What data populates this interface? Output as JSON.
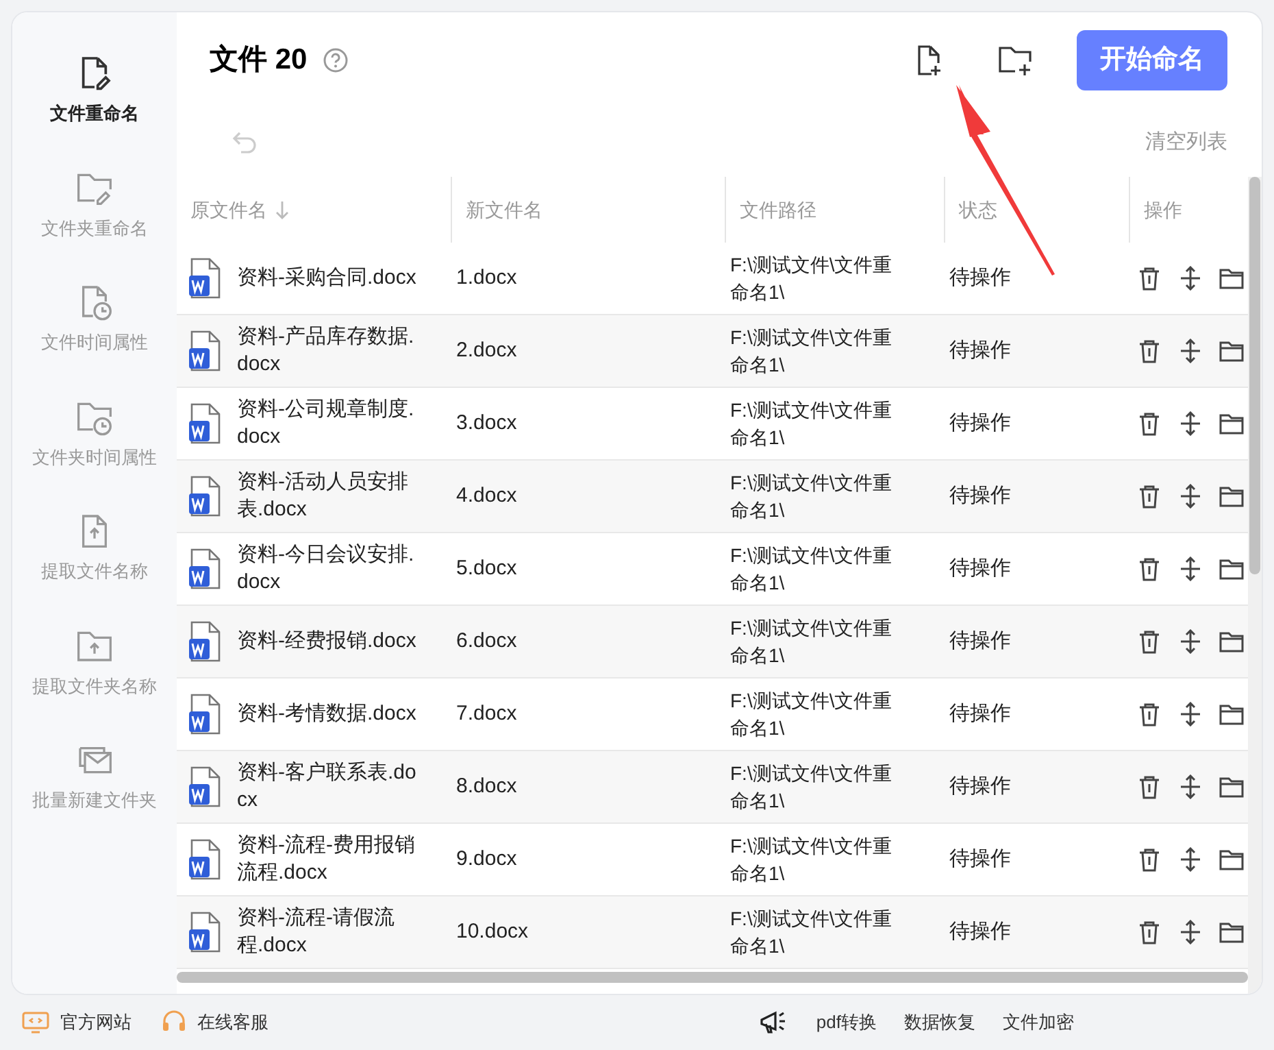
{
  "sidebar": {
    "items": [
      {
        "label": "文件重命名",
        "selected": true
      },
      {
        "label": "文件夹重命名",
        "selected": false
      },
      {
        "label": "文件时间属性",
        "selected": false
      },
      {
        "label": "文件夹时间属性",
        "selected": false
      },
      {
        "label": "提取文件名称",
        "selected": false
      },
      {
        "label": "提取文件夹名称",
        "selected": false
      },
      {
        "label": "批量新建文件夹",
        "selected": false
      }
    ]
  },
  "header": {
    "title": "文件 20",
    "start_button": "开始命名",
    "clear_list": "清空列表"
  },
  "table": {
    "columns": [
      "原文件名",
      "新文件名",
      "文件路径",
      "状态",
      "操作"
    ],
    "rows": [
      {
        "original": "资料-采购合同.docx",
        "new": "1.docx",
        "path": "F:\\测试文件\\文件重命名1\\",
        "status": "待操作"
      },
      {
        "original": "资料-产品库存数据.docx",
        "new": "2.docx",
        "path": "F:\\测试文件\\文件重命名1\\",
        "status": "待操作"
      },
      {
        "original": "资料-公司规章制度.docx",
        "new": "3.docx",
        "path": "F:\\测试文件\\文件重命名1\\",
        "status": "待操作"
      },
      {
        "original": "资料-活动人员安排表.docx",
        "new": "4.docx",
        "path": "F:\\测试文件\\文件重命名1\\",
        "status": "待操作"
      },
      {
        "original": "资料-今日会议安排.docx",
        "new": "5.docx",
        "path": "F:\\测试文件\\文件重命名1\\",
        "status": "待操作"
      },
      {
        "original": "资料-经费报销.docx",
        "new": "6.docx",
        "path": "F:\\测试文件\\文件重命名1\\",
        "status": "待操作"
      },
      {
        "original": "资料-考情数据.docx",
        "new": "7.docx",
        "path": "F:\\测试文件\\文件重命名1\\",
        "status": "待操作"
      },
      {
        "original": "资料-客户联系表.docx",
        "new": "8.docx",
        "path": "F:\\测试文件\\文件重命名1\\",
        "status": "待操作"
      },
      {
        "original": "资料-流程-费用报销流程.docx",
        "new": "9.docx",
        "path": "F:\\测试文件\\文件重命名1\\",
        "status": "待操作"
      },
      {
        "original": "资料-流程-请假流程.docx",
        "new": "10.docx",
        "path": "F:\\测试文件\\文件重命名1\\",
        "status": "待操作"
      }
    ]
  },
  "footer": {
    "left": [
      "官方网站",
      "在线客服"
    ],
    "right": [
      "pdf转换",
      "数据恢复",
      "文件加密"
    ]
  }
}
